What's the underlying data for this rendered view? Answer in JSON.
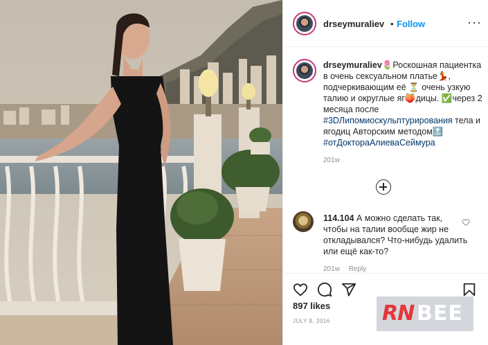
{
  "post": {
    "username": "drseymuraliev",
    "separator": "•",
    "follow_label": "Follow",
    "more_label": "···"
  },
  "caption": {
    "username": "drseymuraliev",
    "emoji_1": "🌷",
    "text_1": "Роскошная пациентка в очень сексуальном платье",
    "emoji_2": "💃",
    "text_2": ", подчеркивающим её ",
    "emoji_3": "⏳",
    "text_3": " очень узкую талию и округлые яг",
    "emoji_4": "🍑",
    "text_4": "дицы. ",
    "emoji_5": "✅",
    "text_5": "через 2 месяца после ",
    "hashtag_1": "#3DЛипомиоскульптурирования",
    "text_6": " тела и ягодиц Авторским методом",
    "emoji_6": "🔝",
    "hashtag_2": "#отДоктораАлиеваСеймура",
    "time": "201w"
  },
  "comment": {
    "username": "114.104",
    "text": "А можно сделать так, чтобы на талии вообще жир не откладывался? Что-нибудь удалить или ещё как-то?",
    "time": "201w",
    "reply_label": "Reply"
  },
  "actions": {
    "like_icon": "heart-icon",
    "comment_icon": "comment-icon",
    "share_icon": "share-icon",
    "save_icon": "bookmark-icon"
  },
  "likes": "897 likes",
  "date": "JULY 8, 2016",
  "watermark": {
    "part_1": "RN",
    "part_2": "BEE"
  },
  "colors": {
    "follow": "#0095f6",
    "hashtag": "#00376b",
    "watermark_red": "#e3262c"
  }
}
